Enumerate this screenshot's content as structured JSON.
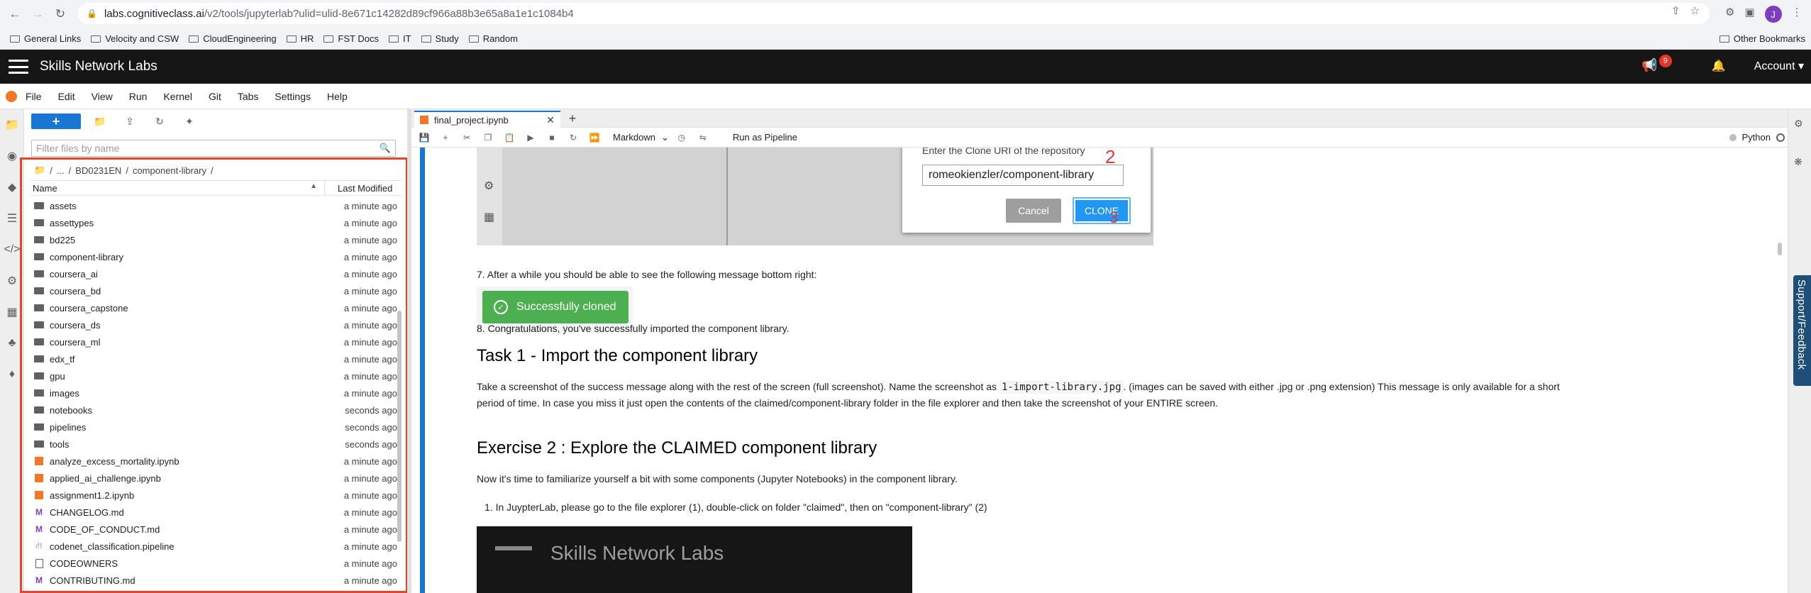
{
  "browser": {
    "url_host": "labs.cognitiveclass.ai",
    "url_path": "/v2/tools/jupyterlab?ulid=ulid-8e671c14282d89cf966a88b3e65a8a1e1c1084b4",
    "profile_initial": "J"
  },
  "bookmarks": {
    "items": [
      "General Links",
      "Velocity and CSW",
      "CloudEngineering",
      "HR",
      "FST Docs",
      "IT",
      "Study",
      "Random"
    ],
    "other": "Other Bookmarks"
  },
  "header": {
    "title": "Skills Network Labs",
    "notification_count": "9",
    "account": "Account"
  },
  "menubar": {
    "items": [
      "File",
      "Edit",
      "View",
      "Run",
      "Kernel",
      "Git",
      "Tabs",
      "Settings",
      "Help"
    ]
  },
  "filebrowser": {
    "filter_placeholder": "Filter files by name",
    "breadcrumb": [
      "/",
      "...",
      "/",
      "BD0231EN",
      "/",
      "component-library",
      "/"
    ],
    "col_name": "Name",
    "col_modified": "Last Modified",
    "files": [
      {
        "name": "assets",
        "type": "folder",
        "modified": "a minute ago"
      },
      {
        "name": "assettypes",
        "type": "folder",
        "modified": "a minute ago"
      },
      {
        "name": "bd225",
        "type": "folder",
        "modified": "a minute ago"
      },
      {
        "name": "component-library",
        "type": "folder",
        "modified": "a minute ago"
      },
      {
        "name": "coursera_ai",
        "type": "folder",
        "modified": "a minute ago"
      },
      {
        "name": "coursera_bd",
        "type": "folder",
        "modified": "a minute ago"
      },
      {
        "name": "coursera_capstone",
        "type": "folder",
        "modified": "a minute ago"
      },
      {
        "name": "coursera_ds",
        "type": "folder",
        "modified": "a minute ago"
      },
      {
        "name": "coursera_ml",
        "type": "folder",
        "modified": "a minute ago"
      },
      {
        "name": "edx_tf",
        "type": "folder",
        "modified": "a minute ago"
      },
      {
        "name": "gpu",
        "type": "folder",
        "modified": "a minute ago"
      },
      {
        "name": "images",
        "type": "folder",
        "modified": "a minute ago"
      },
      {
        "name": "notebooks",
        "type": "folder",
        "modified": "seconds ago"
      },
      {
        "name": "pipelines",
        "type": "folder",
        "modified": "seconds ago"
      },
      {
        "name": "tools",
        "type": "folder",
        "modified": "seconds ago"
      },
      {
        "name": "analyze_excess_mortality.ipynb",
        "type": "notebook",
        "modified": "a minute ago"
      },
      {
        "name": "applied_ai_challenge.ipynb",
        "type": "notebook",
        "modified": "a minute ago"
      },
      {
        "name": "assignment1.2.ipynb",
        "type": "notebook",
        "modified": "a minute ago"
      },
      {
        "name": "CHANGELOG.md",
        "type": "markdown",
        "modified": "a minute ago"
      },
      {
        "name": "CODE_OF_CONDUCT.md",
        "type": "markdown",
        "modified": "a minute ago"
      },
      {
        "name": "codenet_classification.pipeline",
        "type": "pipeline",
        "modified": "a minute ago"
      },
      {
        "name": "CODEOWNERS",
        "type": "file",
        "modified": "a minute ago"
      },
      {
        "name": "CONTRIBUTING.md",
        "type": "markdown",
        "modified": "a minute ago"
      }
    ]
  },
  "notebook": {
    "tab_name": "final_project.ipynb",
    "cell_type": "Markdown",
    "run_pipeline": "Run as Pipeline",
    "kernel": "Python"
  },
  "content": {
    "dialog_label": "Enter the Clone URI of the repository",
    "dialog_input": "romeokienzler/component-library",
    "cancel": "Cancel",
    "clone": "CLONE",
    "step_num_2": "2",
    "step_num_3": "3",
    "step7": "7. After a while you should be able to see the following message bottom right:",
    "toast": "Successfully cloned",
    "step8": "8. Congratulations, you've successfully imported the component library.",
    "task1_title": "Task 1 - Import the component library",
    "task1_text_a": "Take a screenshot of the success message along with the rest of the screen (full screenshot). Name the screenshot as",
    "task1_code": "1-import-library.jpg",
    "task1_text_b": ". (images can be saved with either .jpg or .png extension) This message is only available for a short",
    "task1_text_c": "period of time. In case you miss it just open the contents of the claimed/component-library folder in the file explorer and then take the screenshot of your ENTIRE screen.",
    "ex2_title": "Exercise 2 : Explore the CLAIMED component library",
    "ex2_text": "Now it's time to familiarize yourself a bit with some components (Jupyter Notebooks) in the component library.",
    "ex2_step1": "1. In JuypterLab, please go to the file explorer (1), double-click on folder \"claimed\", then on \"component-library\" (2)",
    "img2_title": "Skills Network Labs"
  },
  "sidebar_right": {
    "support": "Support/Feedback"
  }
}
